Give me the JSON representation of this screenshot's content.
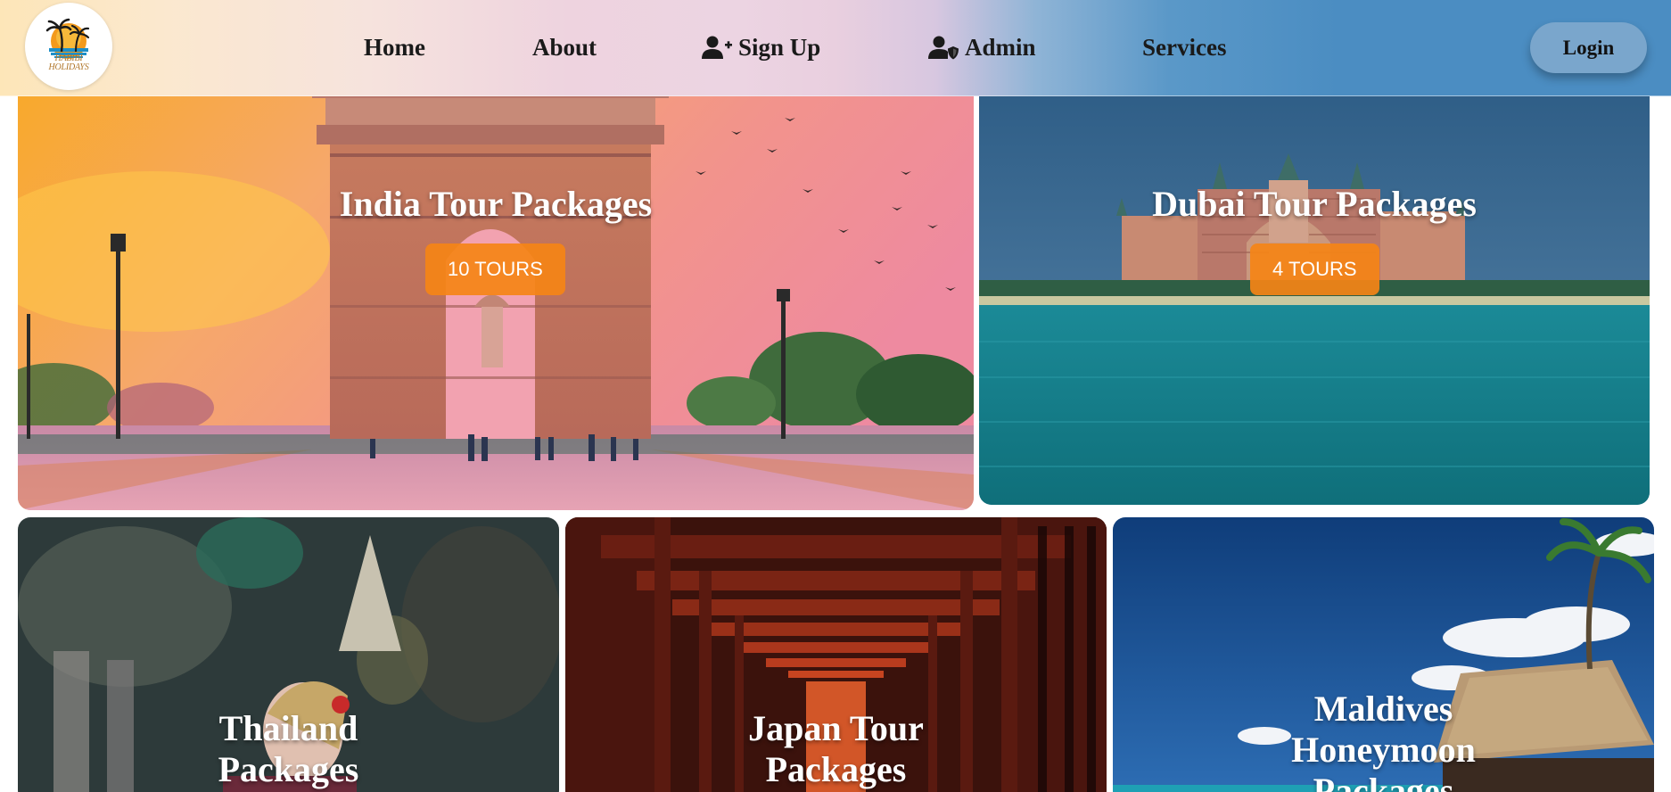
{
  "brand": {
    "logo_text_1": "HABIBI",
    "logo_text_2": "HOLIDAYS"
  },
  "nav": {
    "home": "Home",
    "about": "About",
    "signup": "Sign Up",
    "admin": "Admin",
    "services": "Services",
    "login": "Login"
  },
  "cards": {
    "india": {
      "title": "India Tour Packages",
      "badge": "10 TOURS"
    },
    "dubai": {
      "title": "Dubai Tour Packages",
      "badge": "4 TOURS"
    },
    "thailand": {
      "title_line1": "Thailand",
      "title_line2": "Packages"
    },
    "japan": {
      "title_line1": "Japan Tour",
      "title_line2": "Packages"
    },
    "maldives": {
      "title_line1": "Maldives",
      "title_line2": "Honeymoon",
      "title_line3": "Packages"
    }
  },
  "colors": {
    "badge": "#f58416",
    "login_button": "#7aa6cc",
    "nav_text": "#1a1a1a",
    "card_title": "#ffffff"
  },
  "icons": {
    "signup": "user-plus-icon",
    "admin": "user-shield-icon",
    "logo": "palm-sunset-icon"
  }
}
